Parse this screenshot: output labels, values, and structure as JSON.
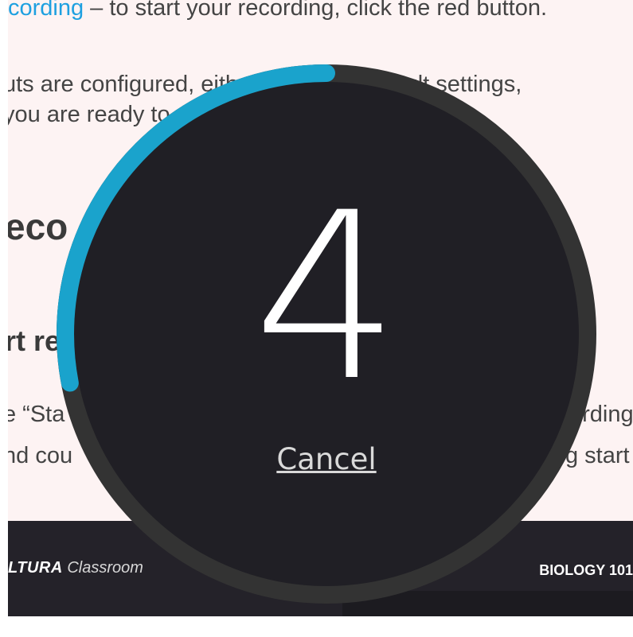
{
  "background_page": {
    "line1_link": "cording",
    "line1_rest": " – to start your recording, click the red button.",
    "line2": "uts are configured, either keep the default settings,",
    "line3": "you are ready to",
    "heading1": "eco",
    "heading2": "rt re",
    "line6": "e “Sta",
    "line6_right": "ording",
    "line7": "nd cou",
    "line7_right": "g start"
  },
  "footer": {
    "brand_bold": "LTURA",
    "brand_italic": " Classroom",
    "course": "BIOLOGY 101"
  },
  "countdown": {
    "number": "4",
    "cancel_label": "Cancel",
    "progress": 0.28,
    "colors": {
      "ring": "#333333",
      "progress": "#1aa3cc",
      "disc": "#201f25"
    }
  }
}
